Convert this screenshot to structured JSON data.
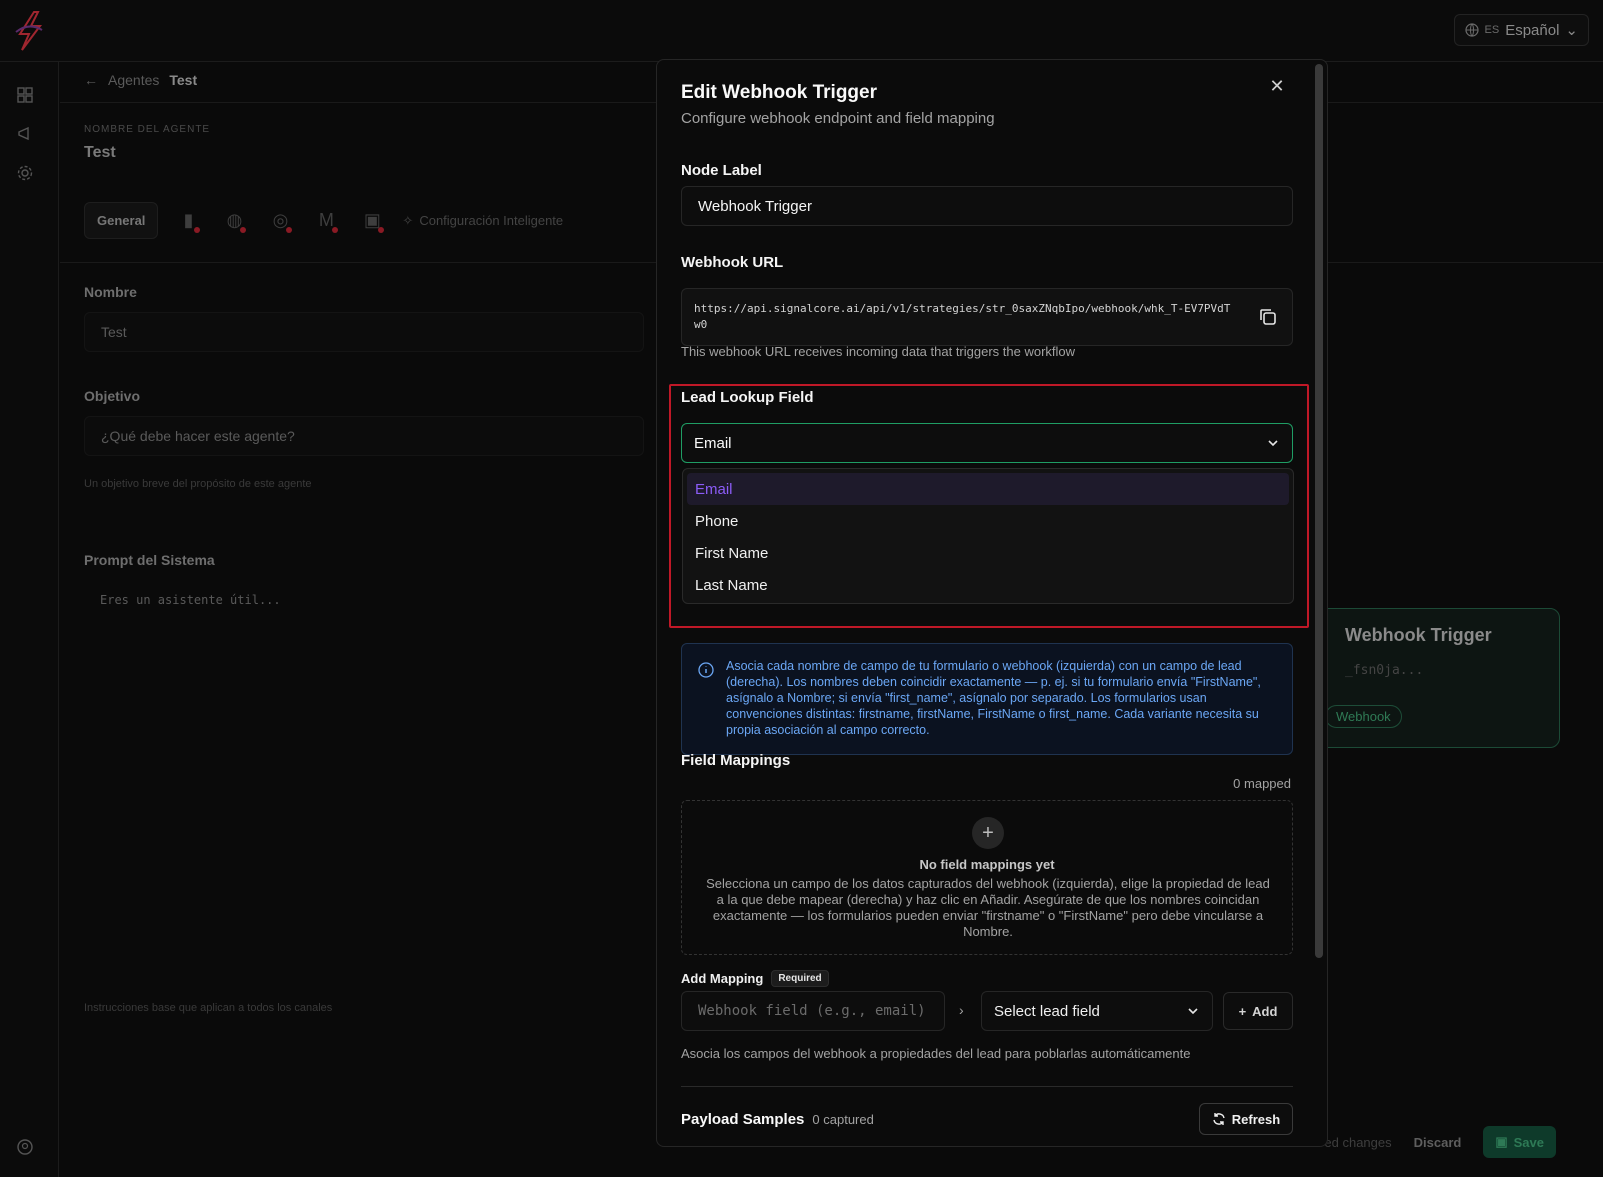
{
  "topbar": {
    "lang_code": "ES",
    "lang_label": "Español"
  },
  "background": {
    "breadcrumb_back": "Agentes",
    "breadcrumb_current": "Test",
    "agent_name_label": "NOMBRE DEL AGENTE",
    "agent_name": "Test",
    "tab_general": "General",
    "tab_smart": "Configuración Inteligente",
    "name_label": "Nombre",
    "name_value": "Test",
    "objective_label": "Objetivo",
    "objective_placeholder": "¿Qué debe hacer este agente?",
    "objective_help": "Un objetivo breve del propósito de este agente",
    "prompt_label": "Prompt del Sistema",
    "prompt_placeholder": "Eres un asistente útil...",
    "prompt_help": "Instrucciones base que aplican a todos los canales",
    "node_title": "Webhook Trigger",
    "node_sub": "_fsn0ja...",
    "node_badge": "Webhook",
    "unsaved": "ed changes",
    "discard": "Discard",
    "save": "Save"
  },
  "modal": {
    "title": "Edit Webhook Trigger",
    "subtitle": "Configure webhook endpoint and field mapping",
    "node_label_label": "Node Label",
    "node_label_value": "Webhook Trigger",
    "webhook_url_label": "Webhook URL",
    "webhook_url": "https://api.signalcore.ai/api/v1/strategies/str_0saxZNqbIpo/webhook/whk_T-EV7PVdTw0",
    "webhook_url_help": "This webhook URL receives incoming data that triggers the workflow",
    "lookup_label": "Lead Lookup Field",
    "lookup_selected": "Email",
    "lookup_options": [
      "Email",
      "Phone",
      "First Name",
      "Last Name"
    ],
    "info_text": "Asocia cada nombre de campo de tu formulario o webhook (izquierda) con un campo de lead (derecha). Los nombres deben coincidir exactamente — p. ej. si tu formulario envía \"FirstName\", asígnalo a Nombre; si envía \"first_name\", asígnalo por separado. Los formularios usan convenciones distintas: firstname, firstName, FirstName o first_name. Cada variante necesita su propia asociación al campo correcto.",
    "field_mappings_label": "Field Mappings",
    "mapped_count": "0 mapped",
    "empty_title": "No field mappings yet",
    "empty_desc": "Selecciona un campo de los datos capturados del webhook (izquierda), elige la propiedad de lead a la que debe mapear (derecha) y haz clic en Añadir. Asegúrate de que los nombres coincidan exactamente — los formularios pueden enviar \"firstname\" o \"FirstName\" pero debe vincularse a Nombre.",
    "add_mapping_label": "Add Mapping",
    "required_badge": "Required",
    "webhook_field_placeholder": "Webhook field (e.g., email)",
    "lead_field_placeholder": "Select lead field",
    "add_button": "Add",
    "add_mapping_help": "Asocia los campos del webhook a propiedades del lead para poblarlas automáticamente",
    "payload_label": "Payload Samples",
    "payload_count": "0 captured",
    "refresh_button": "Refresh"
  },
  "colors": {
    "accent_green": "#1f9d64",
    "highlight_red": "#c01827",
    "selected_purple": "#8b5cf6",
    "info_blue": "#6ba7f5"
  }
}
